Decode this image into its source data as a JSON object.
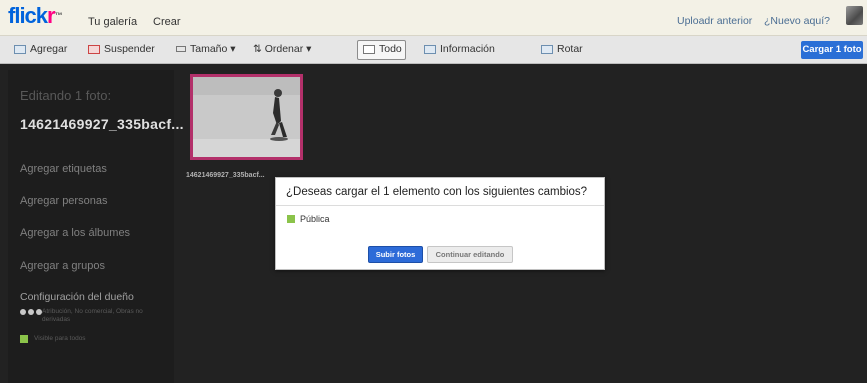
{
  "header": {
    "logo_part1": "flick",
    "logo_part2": "r",
    "logo_tm": "™",
    "nav": [
      "Tu galería",
      "Crear"
    ],
    "right_links": [
      "Uploadr anterior",
      "¿Nuevo aquí?"
    ]
  },
  "toolbar": {
    "add": "Agregar",
    "remove": "Suspender",
    "size": "Tamaño ▾",
    "sort": "⇅ Ordenar ▾",
    "all": "Todo",
    "info": "Información",
    "rotate": "Rotar",
    "upload": "Cargar 1 foto"
  },
  "sidebar": {
    "heading": "Editando 1 foto:",
    "filename": "14621469927_335bacf...",
    "links": [
      "Agregar etiquetas",
      "Agregar personas",
      "Agregar a los álbumes",
      "Agregar a grupos"
    ],
    "owner_settings": "Configuración del dueño",
    "license_text": "Atribución, No comercial, Obras no derivadas",
    "visibility_text": "Visible para todos"
  },
  "photo": {
    "caption": "14621469927_335bacf..."
  },
  "modal": {
    "question": "¿Deseas cargar el 1 elemento con los siguientes cambios?",
    "visibility": "Pública",
    "confirm": "Subir fotos",
    "continue": "Continuar editando"
  },
  "colors": {
    "flickr_blue": "#0063dc",
    "flickr_pink": "#ff0084",
    "primary_button": "#2d6bd8",
    "selection_border": "#b3306a",
    "public_badge": "#8bc34a"
  }
}
